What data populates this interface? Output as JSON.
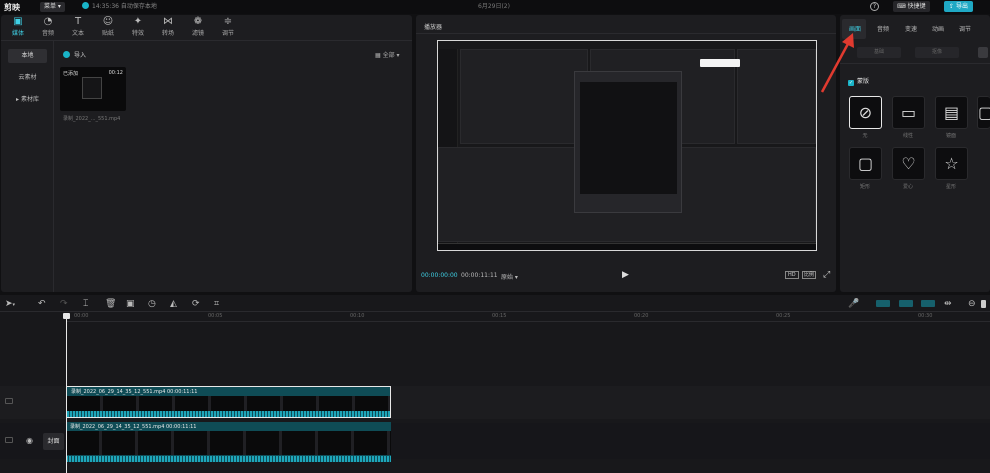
{
  "topbar": {
    "logo": "剪映",
    "menu_label": "菜单",
    "save_status": "14:35:36 自动保存本地",
    "title": "6月29日(2)",
    "shortcut_label": "快捷键",
    "export_label": "导出"
  },
  "tool_tabs": [
    {
      "label": "媒体",
      "icon": "▣"
    },
    {
      "label": "音频",
      "icon": "◔"
    },
    {
      "label": "文本",
      "icon": "T"
    },
    {
      "label": "贴纸",
      "icon": "☺"
    },
    {
      "label": "特效",
      "icon": "✦"
    },
    {
      "label": "转场",
      "icon": "⋈"
    },
    {
      "label": "滤镜",
      "icon": "❁"
    },
    {
      "label": "调节",
      "icon": "≑"
    }
  ],
  "media_sidebar": {
    "local": "本地",
    "cloud": "云素材",
    "library": "素材库"
  },
  "media": {
    "import_label": "导入",
    "view_label": "全部",
    "clip_added": "已添加",
    "clip_duration": "00:12",
    "clip_name": "录制_2022_..._551.mp4"
  },
  "preview": {
    "title": "播放器",
    "time_current": "00:00:00:00",
    "time_total": "00:00:11:11",
    "ratio_label": "原始",
    "quality_label": "HD",
    "fit_label": "比例"
  },
  "props": {
    "tabs": [
      "画面",
      "音频",
      "变速",
      "动画",
      "调节"
    ],
    "sub_tabs": [
      "基础",
      "抠像"
    ],
    "section_label": "蒙版",
    "masks": [
      {
        "label": "无",
        "icon": "⊘"
      },
      {
        "label": "线性",
        "icon": "▭"
      },
      {
        "label": "镜面",
        "icon": "▤"
      },
      {
        "label": "",
        "icon": "▢"
      },
      {
        "label": "矩形",
        "icon": "▢"
      },
      {
        "label": "爱心",
        "icon": "♡"
      },
      {
        "label": "星形",
        "icon": "☆"
      }
    ]
  },
  "timeline": {
    "ticks": [
      "00:00",
      "00:05",
      "00:10",
      "00:15",
      "00:20",
      "00:25",
      "00:30"
    ],
    "clip1_label": "录制_2022_06_29_14_35_12_551.mp4   00:00:11:11",
    "clip2_label": "录制_2022_06_29_14_35_12_551.mp4   00:00:11:11",
    "cover_label": "封面"
  },
  "colors": {
    "accent": "#3fd1e6",
    "clip": "#0f4c56",
    "annotation_arrow": "#e03a2f"
  }
}
